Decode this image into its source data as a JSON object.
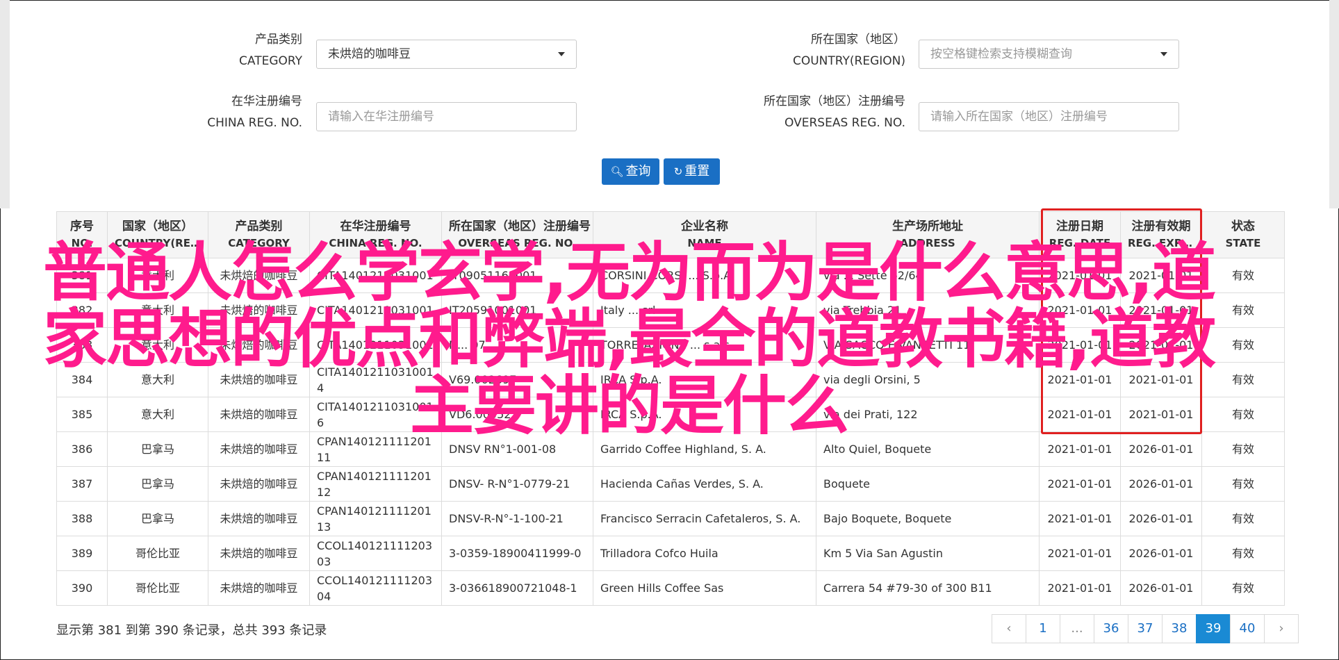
{
  "filters": {
    "category": {
      "label_cn": "产品类别",
      "label_en": "CATEGORY",
      "value": "未烘焙的咖啡豆"
    },
    "country": {
      "label_cn": "所在国家（地区）",
      "label_en": "COUNTRY(REGION)",
      "placeholder": "按空格键检索支持模糊查询"
    },
    "china_reg": {
      "label_cn": "在华注册编号",
      "label_en": "CHINA REG. NO.",
      "placeholder": "请输入在华注册编号"
    },
    "overseas_reg": {
      "label_cn": "所在国家（地区）注册编号",
      "label_en": "OVERSEAS REG. NO.",
      "placeholder": "请输入所在国家（地区）注册编号"
    }
  },
  "buttons": {
    "search": "查询",
    "reset": "重置"
  },
  "table": {
    "headers": [
      {
        "cn": "序号",
        "en": "NO."
      },
      {
        "cn": "国家（地区）",
        "en": "COUNTRY(REGIO..."
      },
      {
        "cn": "产品类别",
        "en": "CATEGORY"
      },
      {
        "cn": "在华注册编号",
        "en": "CHINA REG. NO."
      },
      {
        "cn": "所在国家（地区）注册编号",
        "en": "OVERSEAS REG. NO."
      },
      {
        "cn": "企业名称",
        "en": "NAME"
      },
      {
        "cn": "生产场所地址",
        "en": "ADDRESS"
      },
      {
        "cn": "注册日期",
        "en": "REG. DATE"
      },
      {
        "cn": "注册有效期",
        "en": "REG. EXPIRE ..."
      },
      {
        "cn": "状态",
        "en": "STATE"
      }
    ],
    "rows": [
      {
        "no": "381",
        "country": "意大利",
        "category": "未烘焙的咖啡豆",
        "china_reg": "CITA1401211031001",
        "overseas_reg": "IT09051160001",
        "name": "CORSINI CORSI ... S.p.A.",
        "address": "via ... Sette 62/64",
        "reg_date": "2021-01-01",
        "expire": "2021-01-01",
        "state": "有效"
      },
      {
        "no": "382",
        "country": "意大利",
        "category": "未烘焙的咖啡豆",
        "china_reg": "CITA1401211031001",
        "overseas_reg": "IT20591001001",
        "name": "Italy ... srl",
        "address": "via Trebbia 21",
        "reg_date": "2021-01-01",
        "expire": "2021-01-01",
        "state": "有效"
      },
      {
        "no": "383",
        "country": "意大利",
        "category": "未烘焙的咖啡豆",
        "china_reg": "CITA1401211031001",
        "overseas_reg": "N... 07",
        "name": "TORREFAZIONE ... s.a.s.",
        "address": "VIA SACCO E VANZETTI 11",
        "reg_date": "2021-01-01",
        "expire": "2021-01-01",
        "state": "有效"
      },
      {
        "no": "384",
        "country": "意大利",
        "category": "未烘焙的咖啡豆",
        "china_reg": "CITA14012110310014",
        "overseas_reg": "V69.002697",
        "name": "IRCA S.p.A.",
        "address": "via degli Orsini, 5",
        "reg_date": "2021-01-01",
        "expire": "2021-01-01",
        "state": "有效"
      },
      {
        "no": "385",
        "country": "意大利",
        "category": "未烘焙的咖啡豆",
        "china_reg": "CITA14012110310016",
        "overseas_reg": "VD6.000527",
        "name": "IRCA S.p.A.",
        "address": "via dei Prati, 122",
        "reg_date": "2021-01-01",
        "expire": "2021-01-01",
        "state": "有效"
      },
      {
        "no": "386",
        "country": "巴拿马",
        "category": "未烘焙的咖啡豆",
        "china_reg": "CPAN14012111120111",
        "overseas_reg": "DNSV RN°1-001-08",
        "name": "Garrido Coffee Highland, S. A.",
        "address": "Alto Quiel, Boquete",
        "reg_date": "2021-01-01",
        "expire": "2026-01-01",
        "state": "有效"
      },
      {
        "no": "387",
        "country": "巴拿马",
        "category": "未烘焙的咖啡豆",
        "china_reg": "CPAN14012111120112",
        "overseas_reg": "DNSV- R-N°1-0779-21",
        "name": "Hacienda Cañas Verdes, S. A.",
        "address": "Boquete",
        "reg_date": "2021-01-01",
        "expire": "2026-01-01",
        "state": "有效"
      },
      {
        "no": "388",
        "country": "巴拿马",
        "category": "未烘焙的咖啡豆",
        "china_reg": "CPAN14012111120113",
        "overseas_reg": "DNSV-R-N°-1-100-21",
        "name": "Francisco Serracin Cafetaleros, S. A.",
        "address": "Bajo Boquete, Boquete",
        "reg_date": "2021-01-01",
        "expire": "2026-01-01",
        "state": "有效"
      },
      {
        "no": "389",
        "country": "哥伦比亚",
        "category": "未烘焙的咖啡豆",
        "china_reg": "CCOL14012111120303",
        "overseas_reg": "3-0359-18900411999-0",
        "name": "Trilladora Cofco Huila",
        "address": "Km 5 Via San Agustin",
        "reg_date": "2021-01-01",
        "expire": "2026-01-01",
        "state": "有效"
      },
      {
        "no": "390",
        "country": "哥伦比亚",
        "category": "未烘焙的咖啡豆",
        "china_reg": "CCOL14012111120304",
        "overseas_reg": "3-036618900721048-1",
        "name": "Green Hills Coffee Sas",
        "address": "Carrera 54 #79-30 of 300 B11",
        "reg_date": "2021-01-01",
        "expire": "2026-01-01",
        "state": "有效"
      }
    ]
  },
  "overlay_text": "普通人怎么学玄学,无为而为是什么意思,道家思想的优点和弊端,最全的道教书籍,道教主要讲的是什么",
  "footer": {
    "summary": "显示第 381 到第 390 条记录，总共 393 条记录"
  },
  "pagination": {
    "prev": "‹",
    "first": "1",
    "ellipsis": "...",
    "pages": [
      "36",
      "37",
      "38",
      "39",
      "40"
    ],
    "active": "39",
    "next": "›"
  },
  "colors": {
    "primary": "#1a6fc4",
    "active_page": "#1a8ad4",
    "highlight_box": "#e02020",
    "overlay": "#ff1b8d"
  },
  "icons": {
    "search": "search-icon",
    "reset": "refresh-icon",
    "dropdown": "caret-down-icon"
  }
}
